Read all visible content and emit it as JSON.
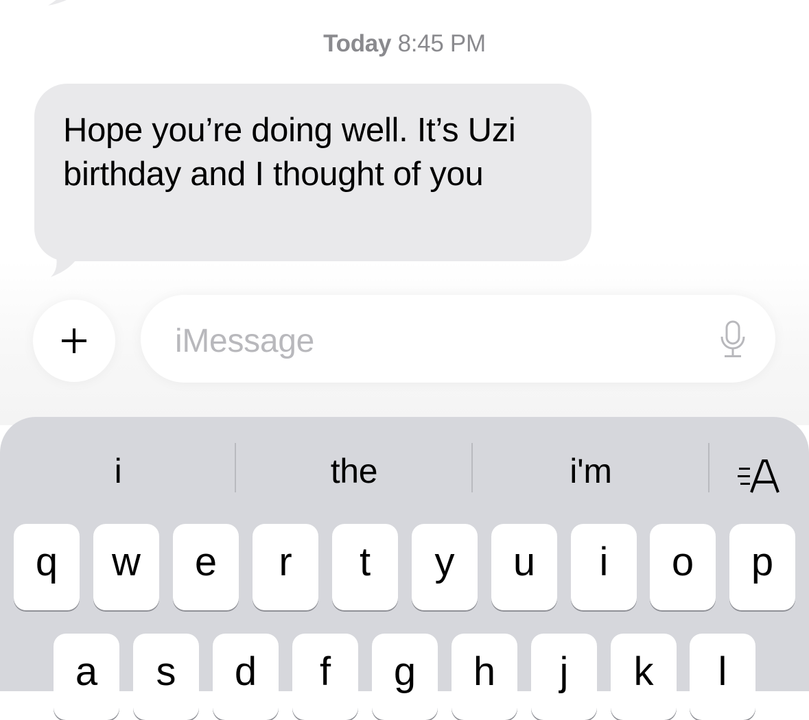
{
  "conversation": {
    "timestamp_day": "Today",
    "timestamp_time": "8:45 PM",
    "messages": [
      {
        "direction": "incoming",
        "text": "Hope you’re doing well. It’s Uzi birthday and I thought of you"
      }
    ]
  },
  "composer": {
    "placeholder": "iMessage",
    "add_icon": "plus-icon",
    "dictation_icon": "microphone-icon"
  },
  "keyboard": {
    "suggestions": [
      "i",
      "the",
      "i'm"
    ],
    "format_icon": "text-format-icon",
    "row1": [
      "q",
      "w",
      "e",
      "r",
      "t",
      "y",
      "u",
      "i",
      "o",
      "p"
    ],
    "row2": [
      "a",
      "s",
      "d",
      "f",
      "g",
      "h",
      "j",
      "k",
      "l"
    ]
  },
  "colors": {
    "incoming_bubble": "#e9e9eb",
    "timestamp": "#8a8a8e",
    "keyboard_bg": "#d6d7dc",
    "placeholder": "#b8b8bc"
  }
}
